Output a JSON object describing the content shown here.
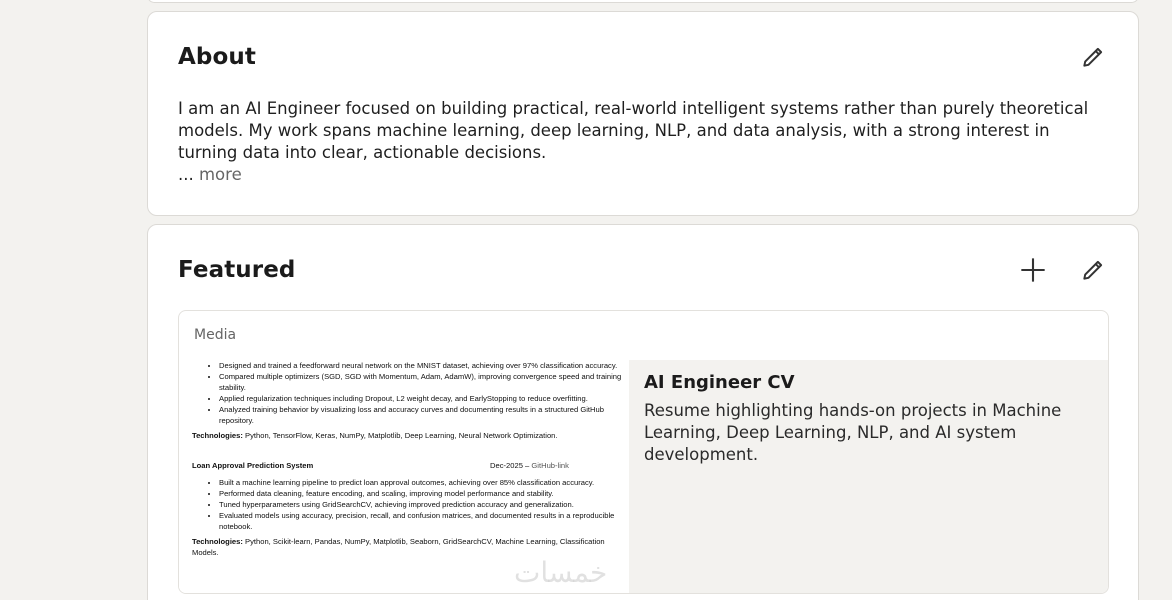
{
  "about": {
    "title": "About",
    "text": "I am an AI Engineer focused on building practical, real-world intelligent systems rather than purely theoretical models. My work spans machine learning, deep learning, NLP, and data analysis, with a strong interest in turning data into clear, actionable decisions.",
    "ellipsis": "... ",
    "more_label": "more",
    "edit_icon": "pencil-icon"
  },
  "featured": {
    "title": "Featured",
    "add_icon": "plus-icon",
    "edit_icon": "pencil-icon",
    "item": {
      "media_label": "Media",
      "title": "AI Engineer CV",
      "description": "Resume highlighting hands-on projects in Machine Learning, Deep Learning, NLP, and AI system development.",
      "preview": {
        "bullets_1": [
          "Designed and trained a feedforward neural network on the MNIST dataset, achieving over 97% classification accuracy.",
          "Compared multiple optimizers (SGD, SGD with Momentum, Adam, AdamW), improving convergence speed and training stability.",
          "Applied regularization techniques including Dropout, L2 weight decay, and EarlyStopping to reduce overfitting.",
          "Analyzed training behavior by visualizing loss and accuracy curves and documenting results in a structured GitHub repository."
        ],
        "tech_label_1": "Technologies:",
        "tech_1": " Python, TensorFlow, Keras, NumPy, Matplotlib, Deep Learning, Neural Network Optimization.",
        "project_title": "Loan Approval Prediction System",
        "project_date": "Dec-2025 – ",
        "project_link": "GitHub-link",
        "bullets_2": [
          "Built a machine learning pipeline to predict loan approval outcomes, achieving over 85% classification accuracy.",
          "Performed data cleaning, feature encoding, and scaling, improving model performance and stability.",
          "Tuned hyperparameters using GridSearchCV, achieving improved prediction accuracy and generalization.",
          "Evaluated models using accuracy, precision, recall, and confusion matrices, and documented results in a reproducible notebook."
        ],
        "tech_label_2": "Technologies:",
        "tech_2": " Python, Scikit-learn, Pandas, NumPy, Matplotlib, Seaborn, GridSearchCV, Machine Learning, Classification Models."
      }
    }
  },
  "watermark": "خمسات"
}
